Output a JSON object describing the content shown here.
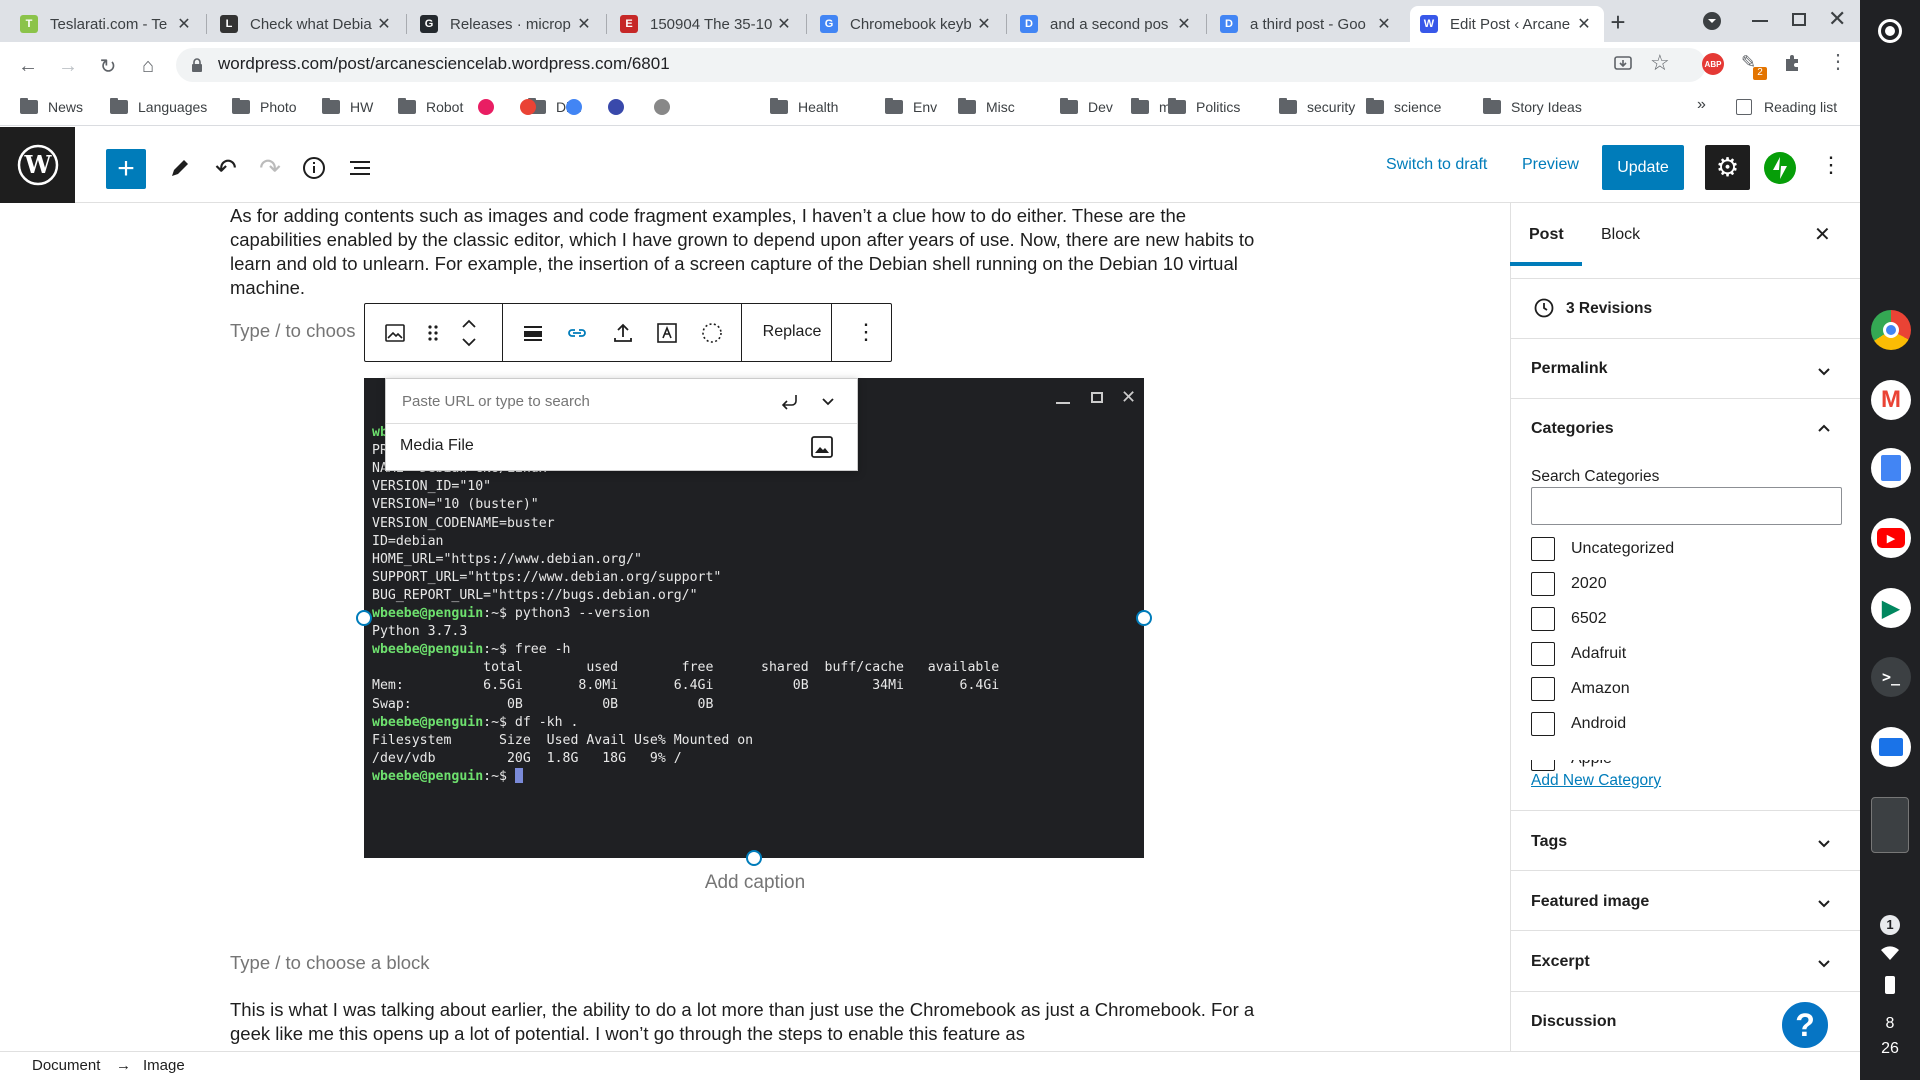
{
  "browser": {
    "tabs": [
      {
        "title": "Teslarati.com - Te",
        "fav": "T",
        "color": "#8bc34a"
      },
      {
        "title": "Check what Debia",
        "fav": "L",
        "color": "#333333"
      },
      {
        "title": "Releases · microp",
        "fav": "G",
        "color": "#24292e"
      },
      {
        "title": "150904 The 35-10",
        "fav": "E",
        "color": "#c62828"
      },
      {
        "title": "Chromebook keyb",
        "fav": "G",
        "color": "#4285f4"
      },
      {
        "title": "and a second pos",
        "fav": "D",
        "color": "#4285f4"
      },
      {
        "title": "a third post - Goo",
        "fav": "D",
        "color": "#4285f4"
      },
      {
        "title": "Edit Post ‹ Arcane",
        "fav": "W",
        "color": "#3858e9"
      }
    ],
    "url": "wordpress.com/post/arcanesciencelab.wordpress.com/6801",
    "bookmarks": [
      "News",
      "Languages",
      "Photo",
      "HW",
      "Robot",
      "Diet",
      "Health",
      "Env",
      "Misc",
      "Dev",
      "mm",
      "Politics",
      "security",
      "science",
      "Story Ideas"
    ],
    "more_bookmarks": "»",
    "reading_list": "Reading list",
    "extension_badge": "2"
  },
  "wp": {
    "switch_to_draft": "Switch to draft",
    "preview": "Preview",
    "update": "Update"
  },
  "editor": {
    "para1": "As for adding contents such as images and code fragment examples, I haven’t a clue how to do either. These are the capabilities enabled by the classic editor, which I have grown to depend upon after years of use. Now, there are new habits to learn and old to unlearn. For example, the insertion of a screen capture of the Debian shell running on the Debian 10 virtual machine.",
    "placeholder_short": "Type / to choos",
    "replace_label": "Replace",
    "link_placeholder": "Paste URL or type to search",
    "media_file": "Media File",
    "caption": "Add caption",
    "placeholder_full": "Type / to choose a block",
    "para2": "This is what I was talking about earlier, the ability to do a lot more than just use the Chromebook as just a Chromebook. For a geek like me this opens up a lot of potential. I won’t go through the steps to enable this feature as"
  },
  "terminal": {
    "lines": [
      {
        "prompt": "wb",
        "text": ""
      },
      {
        "prompt": "",
        "text": "PR"
      },
      {
        "prompt": "",
        "text": "NAME=\"Debian GNU/Linux\""
      },
      {
        "prompt": "",
        "text": "VERSION_ID=\"10\""
      },
      {
        "prompt": "",
        "text": "VERSION=\"10 (buster)\""
      },
      {
        "prompt": "",
        "text": "VERSION_CODENAME=buster"
      },
      {
        "prompt": "",
        "text": "ID=debian"
      },
      {
        "prompt": "",
        "text": "HOME_URL=\"https://www.debian.org/\""
      },
      {
        "prompt": "",
        "text": "SUPPORT_URL=\"https://www.debian.org/support\""
      },
      {
        "prompt": "",
        "text": "BUG_REPORT_URL=\"https://bugs.debian.org/\""
      },
      {
        "prompt": "wbeebe@penguin",
        "text": ":~$ python3 --version"
      },
      {
        "prompt": "",
        "text": "Python 3.7.3"
      },
      {
        "prompt": "wbeebe@penguin",
        "text": ":~$ free -h"
      },
      {
        "prompt": "",
        "text": "              total        used        free      shared  buff/cache   available"
      },
      {
        "prompt": "",
        "text": "Mem:          6.5Gi       8.0Mi       6.4Gi          0B        34Mi       6.4Gi"
      },
      {
        "prompt": "",
        "text": "Swap:            0B          0B          0B"
      },
      {
        "prompt": "wbeebe@penguin",
        "text": ":~$ df -kh ."
      },
      {
        "prompt": "",
        "text": "Filesystem      Size  Used Avail Use% Mounted on"
      },
      {
        "prompt": "",
        "text": "/dev/vdb         20G  1.8G   18G   9% /"
      },
      {
        "prompt": "wbeebe@penguin",
        "text": ":~$ "
      }
    ]
  },
  "sidebar": {
    "tab_post": "Post",
    "tab_block": "Block",
    "revisions": "3 Revisions",
    "permalink": "Permalink",
    "categories": "Categories",
    "search_categories": "Search Categories",
    "category_items": [
      "Uncategorized",
      "2020",
      "6502",
      "Adafruit",
      "Amazon",
      "Android",
      "Apple"
    ],
    "add_new_category": "Add New Category",
    "tags": "Tags",
    "featured_image": "Featured image",
    "excerpt": "Excerpt",
    "discussion": "Discussion"
  },
  "footer": {
    "document": "Document",
    "arrow": "→",
    "image": "Image"
  },
  "shelf": {
    "notif_count": "1",
    "time_hour": "8",
    "time_min": "26"
  }
}
